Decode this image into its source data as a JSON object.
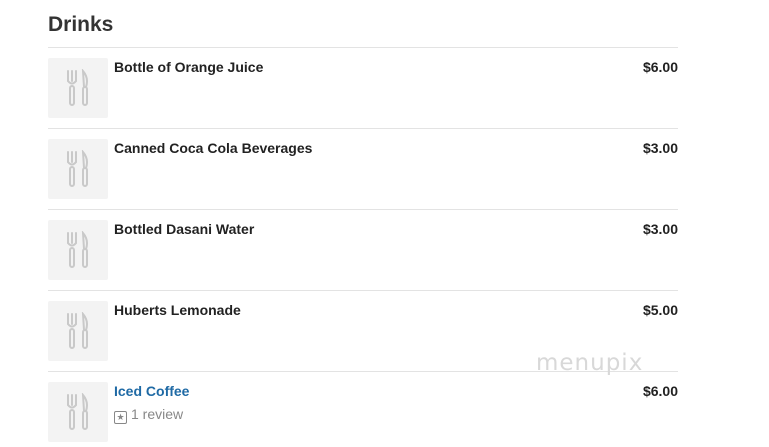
{
  "section": {
    "title": "Drinks"
  },
  "items": [
    {
      "name": "Bottle of Orange Juice",
      "price": "$6.00"
    },
    {
      "name": "Canned Coca Cola Beverages",
      "price": "$3.00"
    },
    {
      "name": "Bottled Dasani Water",
      "price": "$3.00"
    },
    {
      "name": "Huberts Lemonade",
      "price": "$5.00"
    },
    {
      "name": "Iced Coffee",
      "price": "$6.00",
      "review_count": "1 review"
    }
  ],
  "icons": {
    "thumbnail": "fork-knife-icon",
    "review": "star-icon"
  },
  "watermark": "menupix",
  "colors": {
    "link": "#1f6aa5",
    "thumb_bg": "#f3f3f3",
    "divider": "#e3e3e3"
  }
}
